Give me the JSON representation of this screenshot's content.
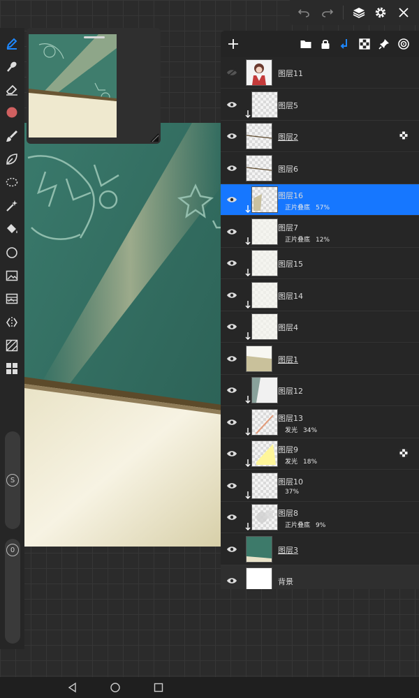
{
  "layers_panel": {
    "layers": [
      {
        "name": "图层11",
        "blend": "",
        "opacity": "",
        "visible": false,
        "clipped": false,
        "folder": false,
        "alpha_lock": false,
        "selected": false,
        "thumb": "character"
      },
      {
        "name": "图层5",
        "blend": "",
        "opacity": "",
        "visible": true,
        "clipped": true,
        "folder": false,
        "alpha_lock": false,
        "selected": false,
        "thumb": "empty"
      },
      {
        "name": "图层2",
        "blend": "",
        "opacity": "",
        "visible": true,
        "clipped": false,
        "folder": true,
        "alpha_lock": true,
        "selected": false,
        "thumb": "line"
      },
      {
        "name": "图层6",
        "blend": "",
        "opacity": "",
        "visible": true,
        "clipped": false,
        "folder": false,
        "alpha_lock": false,
        "selected": false,
        "thumb": "line"
      },
      {
        "name": "图层16",
        "blend": "正片叠底",
        "opacity": "57%",
        "visible": true,
        "clipped": true,
        "folder": false,
        "alpha_lock": false,
        "selected": true,
        "thumb": "beige-corner"
      },
      {
        "name": "图层7",
        "blend": "正片叠底",
        "opacity": "12%",
        "visible": true,
        "clipped": true,
        "folder": false,
        "alpha_lock": false,
        "selected": false,
        "thumb": "faint"
      },
      {
        "name": "图层15",
        "blend": "",
        "opacity": "",
        "visible": true,
        "clipped": true,
        "folder": false,
        "alpha_lock": false,
        "selected": false,
        "thumb": "faint"
      },
      {
        "name": "图层14",
        "blend": "",
        "opacity": "",
        "visible": true,
        "clipped": true,
        "folder": false,
        "alpha_lock": false,
        "selected": false,
        "thumb": "faint"
      },
      {
        "name": "图层4",
        "blend": "",
        "opacity": "",
        "visible": true,
        "clipped": true,
        "folder": false,
        "alpha_lock": false,
        "selected": false,
        "thumb": "faint"
      },
      {
        "name": "图层1",
        "blend": "",
        "opacity": "",
        "visible": true,
        "clipped": false,
        "folder": true,
        "alpha_lock": false,
        "selected": false,
        "thumb": "beige-bottom"
      },
      {
        "name": "图层12",
        "blend": "",
        "opacity": "",
        "visible": true,
        "clipped": true,
        "folder": false,
        "alpha_lock": false,
        "selected": false,
        "thumb": "gray-fade"
      },
      {
        "name": "图层13",
        "blend": "发光",
        "opacity": "34%",
        "visible": true,
        "clipped": true,
        "folder": false,
        "alpha_lock": false,
        "selected": false,
        "thumb": "orange-line"
      },
      {
        "name": "图层9",
        "blend": "发光",
        "opacity": "18%",
        "visible": true,
        "clipped": true,
        "folder": false,
        "alpha_lock": true,
        "selected": false,
        "thumb": "yellow"
      },
      {
        "name": "图层10",
        "blend": "",
        "opacity": "37%",
        "visible": true,
        "clipped": true,
        "folder": false,
        "alpha_lock": false,
        "selected": false,
        "thumb": "empty"
      },
      {
        "name": "图层8",
        "blend": "正片叠底",
        "opacity": "9%",
        "visible": true,
        "clipped": true,
        "folder": false,
        "alpha_lock": false,
        "selected": false,
        "thumb": "gray-blob"
      },
      {
        "name": "图层3",
        "blend": "",
        "opacity": "",
        "visible": true,
        "clipped": false,
        "folder": true,
        "alpha_lock": false,
        "selected": false,
        "thumb": "teal"
      },
      {
        "name": "背景",
        "blend": "",
        "opacity": "",
        "visible": true,
        "clipped": false,
        "folder": false,
        "alpha_lock": false,
        "selected": false,
        "thumb": "white",
        "is_background": true
      }
    ]
  },
  "toolbar": {
    "brush_size_label": "S",
    "opacity_label": "0",
    "primary_color": "#d06060"
  },
  "colors": {
    "selected_row": "#1677ff",
    "accent_icon": "#1e88ff",
    "chalkboard": "#2f6b5e",
    "wall": "#ece7cf"
  }
}
